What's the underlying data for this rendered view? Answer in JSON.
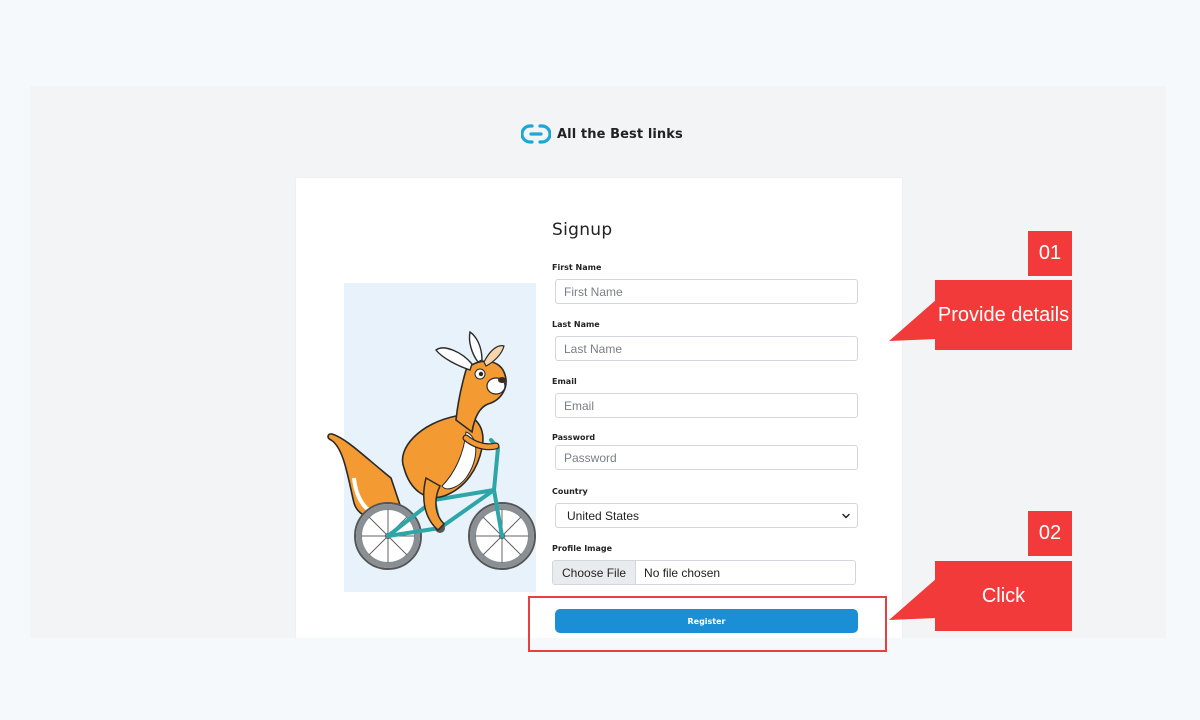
{
  "brand": {
    "name": "All the Best links",
    "logo_icon": "link-logo-icon",
    "accent": "#1ba8d6"
  },
  "signup": {
    "title": "Signup",
    "first_name": {
      "label": "First Name",
      "placeholder": "First Name"
    },
    "last_name": {
      "label": "Last Name",
      "placeholder": "Last Name"
    },
    "email": {
      "label": "Email",
      "placeholder": "Email"
    },
    "password": {
      "label": "Password",
      "placeholder": "Password"
    },
    "country": {
      "label": "Country",
      "value": "United States"
    },
    "profile_image": {
      "label": "Profile Image",
      "button": "Choose File",
      "status": "No file chosen"
    },
    "register_label": "Register"
  },
  "illustration": "kangaroo-on-bicycle",
  "callouts": [
    {
      "number": "01",
      "text": "Provide details"
    },
    {
      "number": "02",
      "text": "Click"
    }
  ],
  "colors": {
    "primary_button": "#1b8fd5",
    "callout": "#f23a3a",
    "illustration_bg": "#e8f2fa",
    "page_bg": "#f5f9fc"
  }
}
